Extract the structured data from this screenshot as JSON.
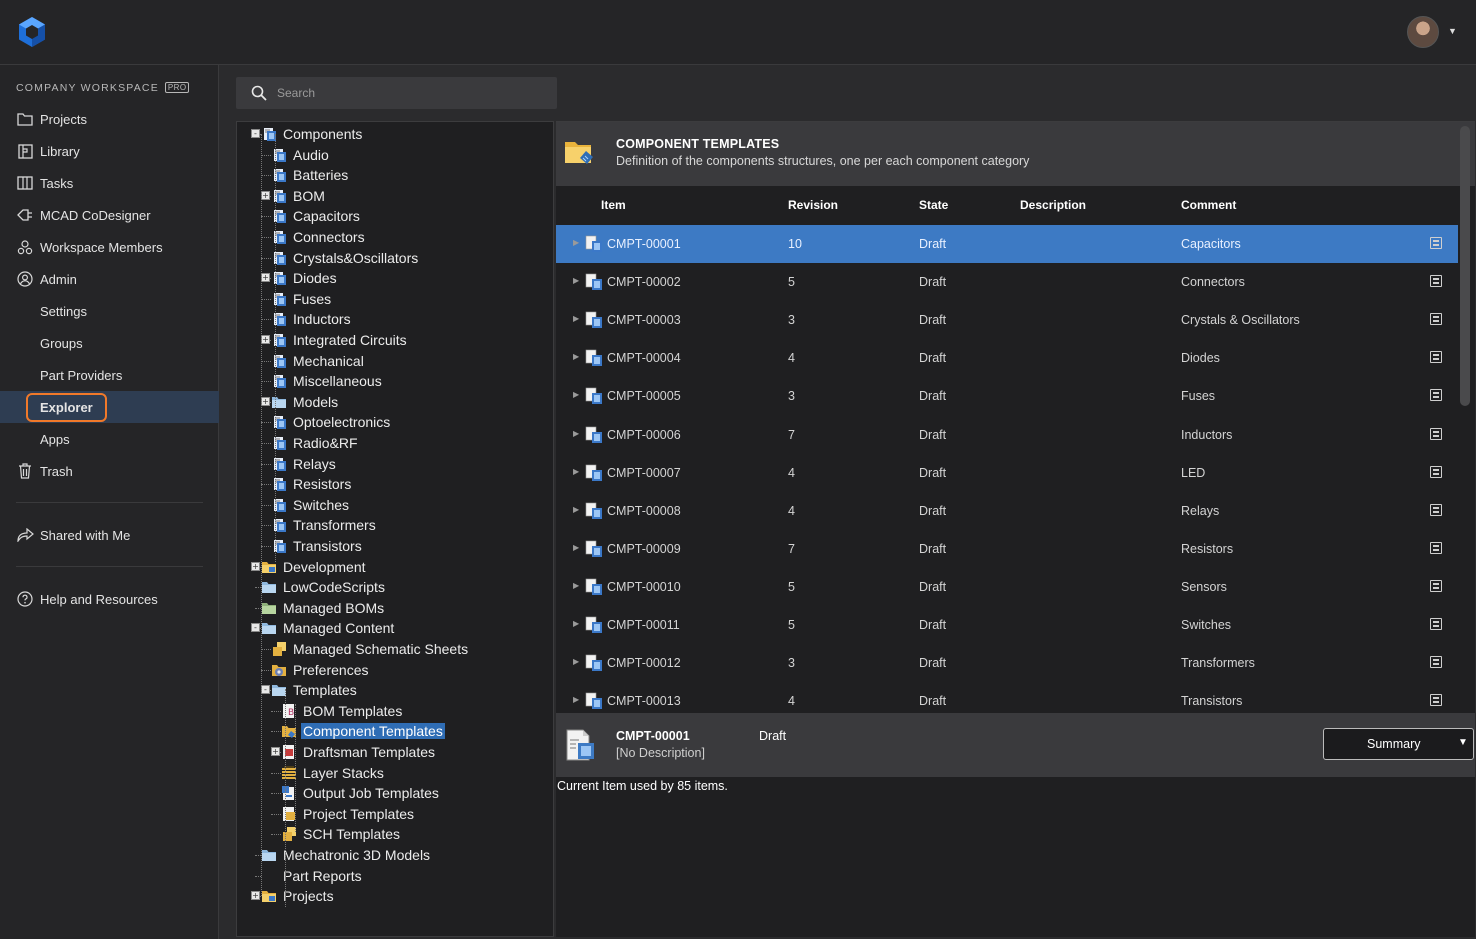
{
  "app": {
    "logo_icon": "altium-365-logo-icon",
    "accent": "#2f6db5",
    "highlight": "#f0792a"
  },
  "user": {
    "avatar_icon": "user-avatar-icon"
  },
  "sidebar": {
    "workspace_title": "COMPANY WORKSPACE",
    "badge": "PRO",
    "items": [
      {
        "label": "Projects",
        "icon": "folder-icon"
      },
      {
        "label": "Library",
        "icon": "library-icon"
      },
      {
        "label": "Tasks",
        "icon": "tasks-icon"
      },
      {
        "label": "MCAD CoDesigner",
        "icon": "mcad-icon"
      },
      {
        "label": "Workspace Members",
        "icon": "members-icon"
      },
      {
        "label": "Admin",
        "icon": "admin-icon"
      },
      {
        "label": "Settings"
      },
      {
        "label": "Groups"
      },
      {
        "label": "Part Providers"
      },
      {
        "label": "Explorer"
      },
      {
        "label": "Apps"
      },
      {
        "label": "Trash",
        "icon": "trash-icon"
      }
    ],
    "shared": "Shared with Me",
    "help": "Help and Resources"
  },
  "search": {
    "placeholder": "Search"
  },
  "tree": [
    "Components",
    "Audio",
    "Batteries",
    "BOM",
    "Capacitors",
    "Connectors",
    "Crystals&Oscillators",
    "Diodes",
    "Fuses",
    "Inductors",
    "Integrated Circuits",
    "Mechanical",
    "Miscellaneous",
    "Models",
    "Optoelectronics",
    "Radio&RF",
    "Relays",
    "Resistors",
    "Switches",
    "Transformers",
    "Transistors",
    "Development",
    "LowCodeScripts",
    "Managed BOMs",
    "Managed Content",
    "Managed Schematic Sheets",
    "Preferences",
    "Templates",
    "BOM Templates",
    "Component Templates",
    "Draftsman Templates",
    "Layer Stacks",
    "Output Job Templates",
    "Project Templates",
    "SCH Templates",
    "Mechatronic 3D Models",
    "Part Reports",
    "Projects"
  ],
  "folder": {
    "title": "COMPONENT TEMPLATES",
    "description": "Definition of the components structures, one per each component category"
  },
  "table": {
    "columns": [
      "Item",
      "Revision",
      "State",
      "Description",
      "Comment"
    ],
    "rows": [
      {
        "item": "CMPT-00001",
        "revision": "10",
        "state": "Draft",
        "description": "",
        "comment": "Capacitors"
      },
      {
        "item": "CMPT-00002",
        "revision": "5",
        "state": "Draft",
        "description": "",
        "comment": "Connectors"
      },
      {
        "item": "CMPT-00003",
        "revision": "3",
        "state": "Draft",
        "description": "",
        "comment": "Crystals & Oscillators"
      },
      {
        "item": "CMPT-00004",
        "revision": "4",
        "state": "Draft",
        "description": "",
        "comment": "Diodes"
      },
      {
        "item": "CMPT-00005",
        "revision": "3",
        "state": "Draft",
        "description": "",
        "comment": "Fuses"
      },
      {
        "item": "CMPT-00006",
        "revision": "7",
        "state": "Draft",
        "description": "",
        "comment": "Inductors"
      },
      {
        "item": "CMPT-00007",
        "revision": "4",
        "state": "Draft",
        "description": "",
        "comment": "LED"
      },
      {
        "item": "CMPT-00008",
        "revision": "4",
        "state": "Draft",
        "description": "",
        "comment": "Relays"
      },
      {
        "item": "CMPT-00009",
        "revision": "7",
        "state": "Draft",
        "description": "",
        "comment": "Resistors"
      },
      {
        "item": "CMPT-00010",
        "revision": "5",
        "state": "Draft",
        "description": "",
        "comment": "Sensors"
      },
      {
        "item": "CMPT-00011",
        "revision": "5",
        "state": "Draft",
        "description": "",
        "comment": "Switches"
      },
      {
        "item": "CMPT-00012",
        "revision": "3",
        "state": "Draft",
        "description": "",
        "comment": "Transformers"
      },
      {
        "item": "CMPT-00013",
        "revision": "4",
        "state": "Draft",
        "description": "",
        "comment": "Transistors"
      }
    ]
  },
  "detail": {
    "item": "CMPT-00001",
    "description": "[No Description]",
    "state": "Draft",
    "view_select": "Summary",
    "usage": "Current Item used by 85 items."
  }
}
